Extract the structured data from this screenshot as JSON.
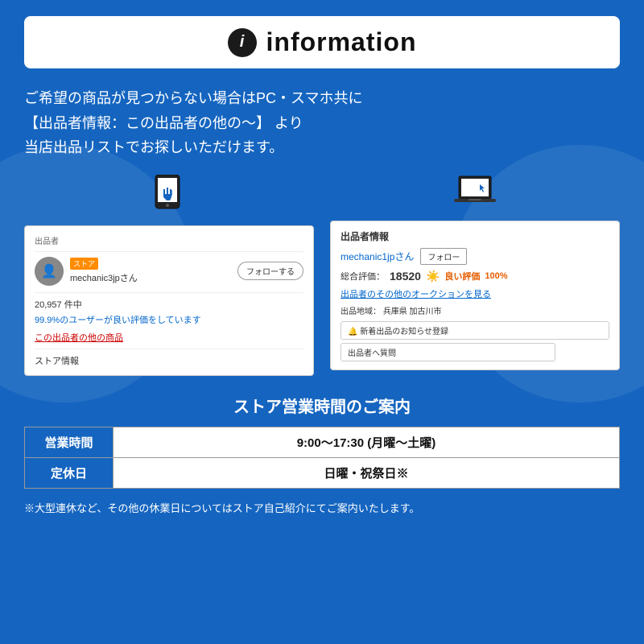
{
  "header": {
    "icon_label": "i",
    "title": "information"
  },
  "main_text": {
    "line1": "ご希望の商品が見つからない場合はPC・スマホ共に",
    "line2": "【出品者情報：この出品者の他の〜】 より",
    "line3": "当店出品リストでお探しいただけます。"
  },
  "left_panel": {
    "section_label": "出品者",
    "store_badge": "ストア",
    "username": "mechanic3jpさん",
    "follow_button": "フォローする",
    "count": "20,957 件中",
    "rating": "99.9%のユーザーが良い評価をしています",
    "products_link": "この出品者の他の商品",
    "store_info": "ストア情報"
  },
  "right_panel": {
    "section_label": "出品者情報",
    "username": "mechanic1jpさん",
    "follow_button": "フォロー",
    "total_label": "総合評価：",
    "total_score": "18520",
    "good_label": "良い評価",
    "good_percent": "100%",
    "auction_link": "出品者のその他のオークションを見る",
    "location_label": "出品地域：",
    "location": "兵庫県 加古川市",
    "notify_button": "🔔 新着出品のお知らせ登録",
    "question_button": "出品者へ質問"
  },
  "hours": {
    "title": "ストア営業時間のご案内",
    "rows": [
      {
        "label": "営業時間",
        "value": "9:00〜17:30 (月曜〜土曜)"
      },
      {
        "label": "定休日",
        "value": "日曜・祝祭日※"
      }
    ]
  },
  "note": "※大型連休など、その他の休業日についてはストア自己紹介にてご案内いたします。",
  "icons": {
    "smartphone": "📱",
    "laptop": "💻"
  }
}
